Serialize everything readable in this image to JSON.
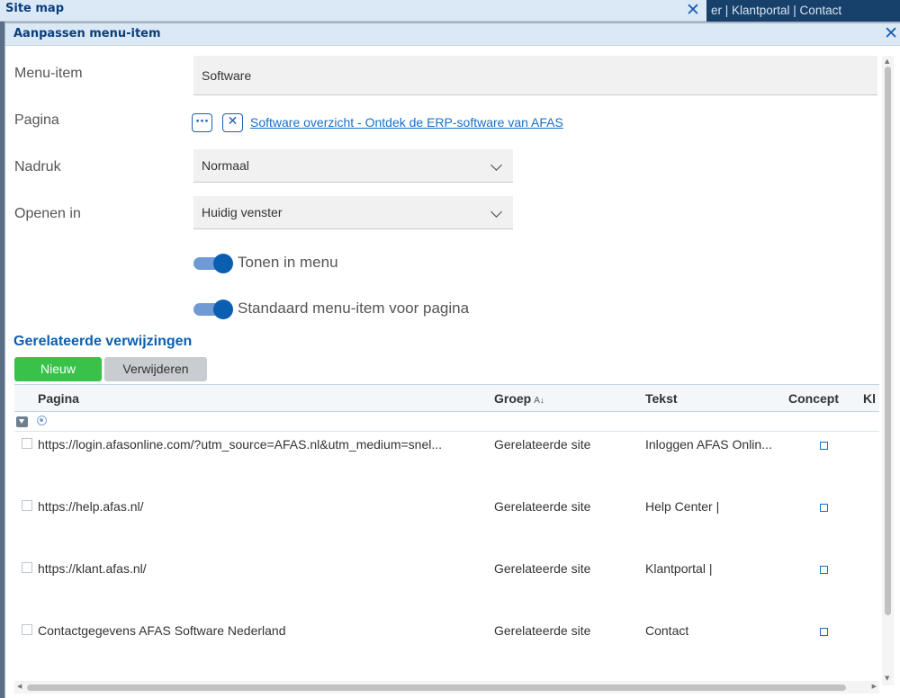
{
  "background": {
    "sitemap_title": "Site map",
    "nav_text": "er |  Klantportal |  Contact"
  },
  "dialog": {
    "title": "Aanpassen menu-item"
  },
  "form": {
    "menu_item_label": "Menu-item",
    "menu_item_value": "Software",
    "page_label": "Pagina",
    "page_link": "Software overzicht - Ontdek de ERP-software van AFAS",
    "emphasis_label": "Nadruk",
    "emphasis_value": "Normaal",
    "open_in_label": "Openen in",
    "open_in_value": "Huidig venster",
    "toggle_menu_label": "Tonen in menu",
    "toggle_default_label": "Standaard menu-item voor pagina"
  },
  "related": {
    "title": "Gerelateerde verwijzingen",
    "new_button": "Nieuw",
    "delete_button": "Verwijderen",
    "columns": {
      "pagina": "Pagina",
      "groep": "Groep",
      "tekst": "Tekst",
      "concept": "Concept",
      "extra": "Kl"
    },
    "rows": [
      {
        "pagina": "https://login.afasonline.com/?utm_source=AFAS.nl&utm_medium=snel...",
        "groep": "Gerelateerde site",
        "tekst": "Inloggen AFAS Onlin..."
      },
      {
        "pagina": "https://help.afas.nl/",
        "groep": "Gerelateerde site",
        "tekst": "Help Center |"
      },
      {
        "pagina": "https://klant.afas.nl/",
        "groep": "Gerelateerde site",
        "tekst": "Klantportal |"
      },
      {
        "pagina": "Contactgegevens AFAS Software Nederland",
        "groep": "Gerelateerde site",
        "tekst": "Contact"
      }
    ]
  },
  "icons": {
    "close": "close-icon",
    "more": "ellipsis-icon",
    "clear": "clear-icon",
    "chevron": "chevron-down-icon",
    "sort": "sort-az-icon",
    "filter": "filter-icon"
  }
}
